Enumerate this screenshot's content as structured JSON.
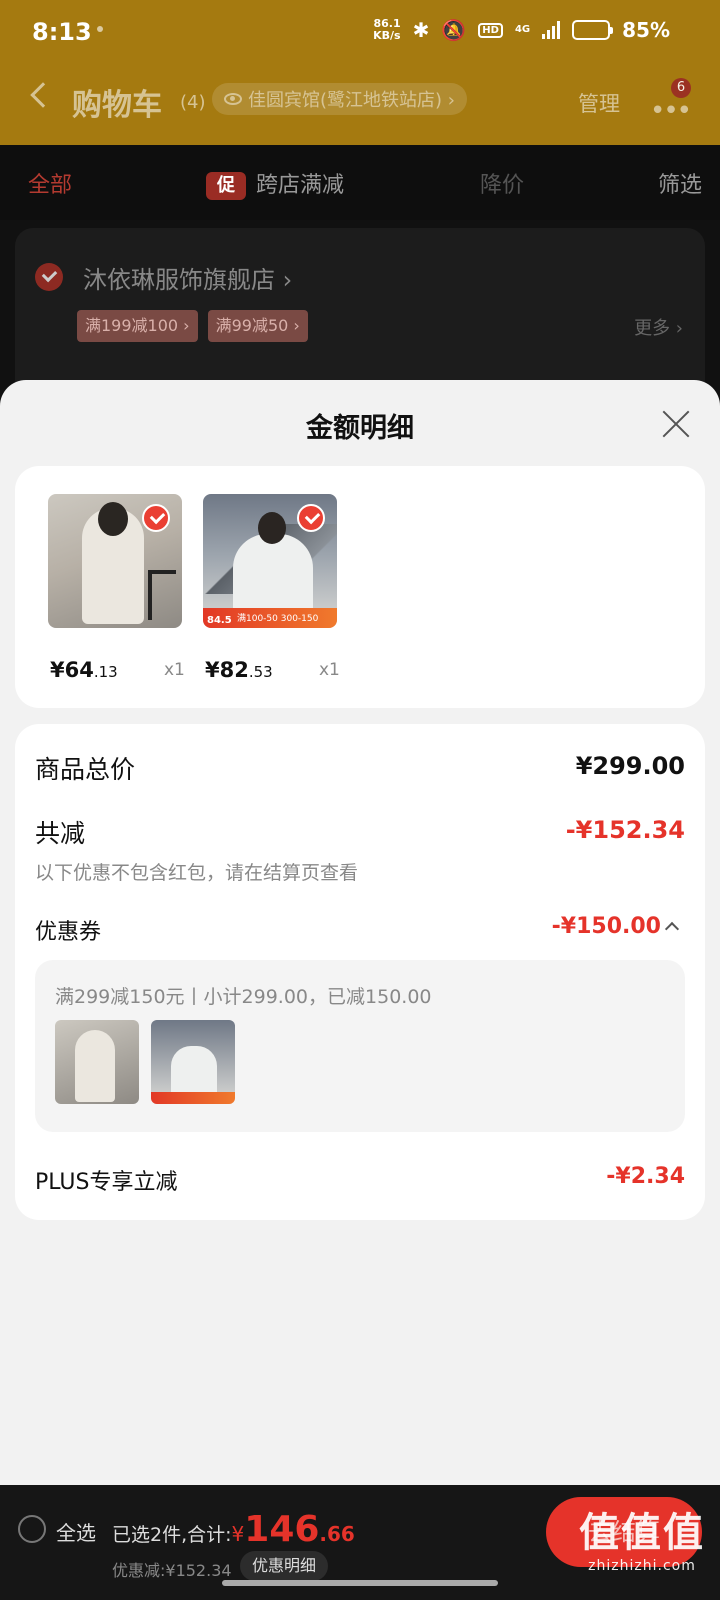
{
  "status_bar": {
    "time": "8:13",
    "net_speed_value": "86.1",
    "net_speed_unit": "KB/s",
    "hd_badge": "HD",
    "network": "4G",
    "battery_level": 0.85,
    "battery_text": "85%"
  },
  "header": {
    "title": "购物车",
    "count": "(4)",
    "address": "佳圆宾馆(鹭江地铁站店) ›",
    "manage": "管理",
    "notification_badge": "6"
  },
  "filter_tabs": [
    {
      "label": "全部"
    },
    {
      "label": "跨店满减",
      "icon": "促"
    },
    {
      "label": "降价"
    },
    {
      "label": "筛选"
    }
  ],
  "store": {
    "name": "沐依琳服饰旗舰店 ›",
    "coupon_tags": [
      "满199减100 ›",
      "满99减50 ›"
    ],
    "more": "更多 ›"
  },
  "sheet": {
    "title": "金额明细",
    "items": [
      {
        "price_int": "¥64",
        "price_dec": ".13",
        "qty": "x1",
        "image": "woman-white-coat"
      },
      {
        "price_int": "¥82",
        "price_dec": ".53",
        "qty": "x1",
        "image": "man-white-jacket",
        "strip_price": "84.5",
        "strip_text": "满100-50 300-150"
      }
    ],
    "total_label": "商品总价",
    "total_value": "¥299.00",
    "reduce_label": "共减",
    "reduce_value": "-¥152.34",
    "note": "以下优惠不包含红包，请在结算页查看",
    "coupon_label": "优惠券",
    "coupon_value": "-¥150.00",
    "coupon_desc": "满299减150元丨小计299.00，已减150.00",
    "plus_label": "PLUS专享立减",
    "plus_value": "-¥2.34"
  },
  "checkout": {
    "select_all": "全选",
    "summary_prefix": "已选2件,合计:",
    "yen": "¥",
    "total_int": "146",
    "total_dec": ".66",
    "discount": "优惠减:¥152.34",
    "detail_button": "优惠明细",
    "checkout_button": "去结算"
  },
  "watermark": {
    "main": "值值值",
    "url": "zhizhizhi.com"
  },
  "colors": {
    "accent_red": "#e5332a",
    "header_gold": "#a57a10",
    "sheet_bg": "#f2f2f2"
  }
}
